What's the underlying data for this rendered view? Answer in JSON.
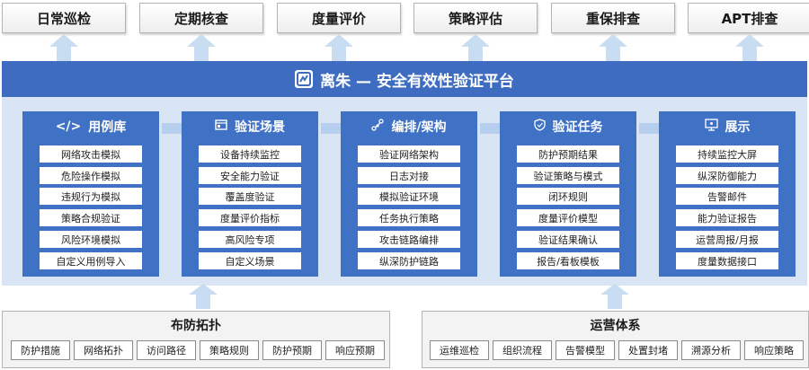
{
  "top_boxes": [
    "日常巡检",
    "定期核查",
    "度量评价",
    "策略评估",
    "重保排查",
    "APT排查"
  ],
  "platform_title": "离朱 — 安全有效性验证平台",
  "columns": [
    {
      "title": "用例库",
      "icon": "code-icon",
      "items": [
        "网络攻击模拟",
        "危险操作模拟",
        "违规行为模拟",
        "策略合规验证",
        "风险环境模拟",
        "自定义用例导入"
      ]
    },
    {
      "title": "验证场景",
      "icon": "scene-icon",
      "items": [
        "设备持续监控",
        "安全能力验证",
        "覆盖度验证",
        "度量评价指标",
        "高风险专项",
        "自定义场景"
      ]
    },
    {
      "title": "编排/架构",
      "icon": "network-icon",
      "items": [
        "验证网络架构",
        "日志对接",
        "模拟验证环境",
        "任务执行策略",
        "攻击链路编排",
        "纵深防护链路"
      ]
    },
    {
      "title": "验证任务",
      "icon": "shield-icon",
      "items": [
        "防护预期结果",
        "验证策略与模式",
        "闭环规则",
        "度量评价模型",
        "验证结果确认",
        "报告/看板模板"
      ]
    },
    {
      "title": "展示",
      "icon": "monitor-icon",
      "items": [
        "持续监控大屏",
        "纵深防御能力",
        "告警邮件",
        "能力验证报告",
        "运营周报/月报",
        "度量数据接口"
      ]
    }
  ],
  "bottom_left": {
    "title": "布防拓扑",
    "items": [
      "防护措施",
      "网络拓扑",
      "访问路径",
      "策略规则",
      "防护预期",
      "响应预期"
    ]
  },
  "bottom_right": {
    "title": "运营体系",
    "items": [
      "运维巡检",
      "组织流程",
      "告警模型",
      "处置封堵",
      "溯源分析",
      "响应策略"
    ]
  }
}
